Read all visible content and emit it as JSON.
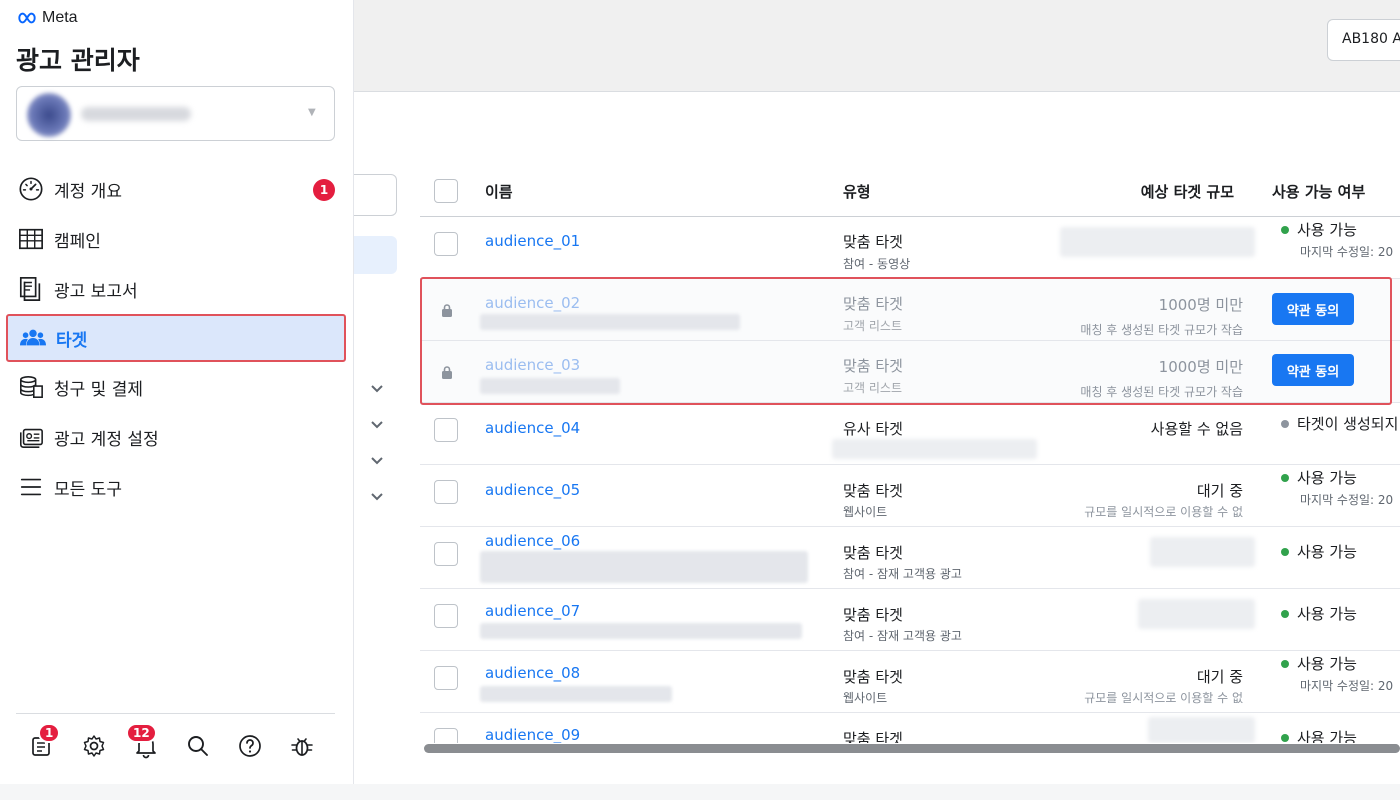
{
  "brand": {
    "logo_text": "Meta",
    "app_title": "광고 관리자"
  },
  "topbar": {
    "account_button": "AB180 A"
  },
  "sidebar": {
    "items": [
      {
        "label": "계정 개요",
        "icon": "dashboard-gauge-icon",
        "badge": "1"
      },
      {
        "label": "캠페인",
        "icon": "table-grid-icon"
      },
      {
        "label": "광고 보고서",
        "icon": "report-pages-icon"
      },
      {
        "label": "타겟",
        "icon": "audience-people-icon",
        "active": true
      },
      {
        "label": "청구 및 결제",
        "icon": "billing-coins-icon"
      },
      {
        "label": "광고 계정 설정",
        "icon": "ad-account-settings-icon"
      },
      {
        "label": "모든 도구",
        "icon": "hamburger-menu-icon"
      }
    ],
    "bottom_icons": [
      {
        "name": "notifications-feed-icon",
        "badge": "1"
      },
      {
        "name": "gear-icon"
      },
      {
        "name": "bell-icon",
        "badge": "12"
      },
      {
        "name": "search-icon"
      },
      {
        "name": "help-icon"
      },
      {
        "name": "bug-report-icon"
      }
    ]
  },
  "table": {
    "headers": {
      "name": "이름",
      "type": "유형",
      "size": "예상 타겟 규모",
      "availability": "사용 가능 여부"
    },
    "rows": [
      {
        "name": "audience_01",
        "type": "맞춤 타겟",
        "subtype": "참여 - 동영상",
        "status": "사용 가능",
        "status_sub": "마지막 수정일: 20"
      },
      {
        "name": "audience_02",
        "type": "맞춤 타겟",
        "subtype": "고객 리스트",
        "size": "1000명 미만",
        "size_sub": "매칭 후 생성된 타겟 규모가 작습",
        "action": "약관 동의"
      },
      {
        "name": "audience_03",
        "type": "맞춤 타겟",
        "subtype": "고객 리스트",
        "size": "1000명 미만",
        "size_sub": "매칭 후 생성된 타겟 규모가 작습",
        "action": "약관 동의"
      },
      {
        "name": "audience_04",
        "type": "유사 타겟",
        "size": "사용할 수 없음",
        "status": "타겟이 생성되지"
      },
      {
        "name": "audience_05",
        "type": "맞춤 타겟",
        "subtype": "웹사이트",
        "size": "대기 중",
        "size_sub": "규모를 일시적으로 이용할 수 없",
        "status": "사용 가능",
        "status_sub": "마지막 수정일: 20"
      },
      {
        "name": "audience_06",
        "type": "맞춤 타겟",
        "subtype": "참여 - 잠재 고객용 광고",
        "status": "사용 가능"
      },
      {
        "name": "audience_07",
        "type": "맞춤 타겟",
        "subtype": "참여 - 잠재 고객용 광고",
        "status": "사용 가능"
      },
      {
        "name": "audience_08",
        "type": "맞춤 타겟",
        "subtype": "웹사이트",
        "size": "대기 중",
        "size_sub": "규모를 일시적으로 이용할 수 없",
        "status": "사용 가능",
        "status_sub": "마지막 수정일: 20"
      },
      {
        "name": "audience_09",
        "type": "맞춤 타겟",
        "status": "사용 가능"
      }
    ]
  },
  "colors": {
    "accent": "#1877f2",
    "highlight": "#e0525b",
    "available": "#31a24c",
    "badge": "#e41e3f"
  }
}
